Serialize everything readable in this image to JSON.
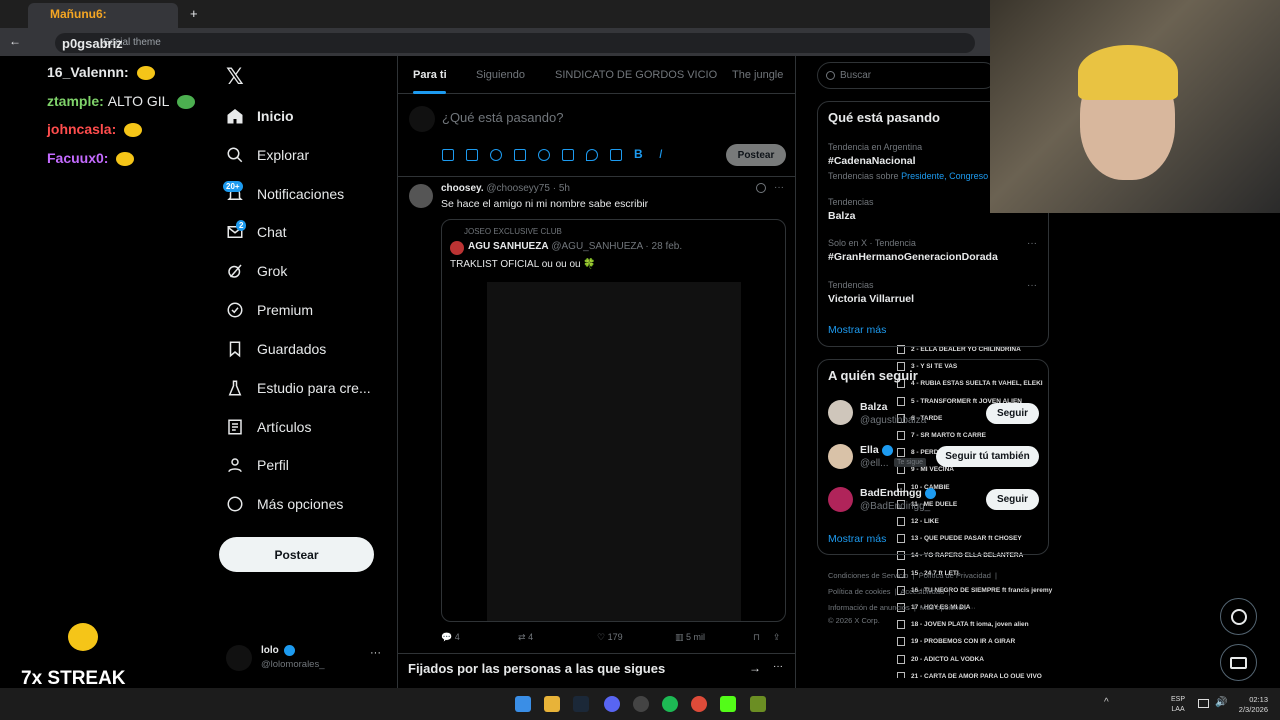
{
  "browser": {
    "tab_title": "Mañunu6:",
    "address_overlay": "p0gsabriz",
    "address_text": "Social theme"
  },
  "chat": [
    {
      "user": "16_Valennn:",
      "msg": "",
      "color": "#e7e9ea"
    },
    {
      "user": "ztample:",
      "msg": "ALTO GIL",
      "color": "#7fd26a"
    },
    {
      "user": "johncasla:",
      "msg": "",
      "color": "#ff4d4d"
    },
    {
      "user": "Facuux0:",
      "msg": "",
      "color": "#c46bff"
    }
  ],
  "streak": "7x STREAK",
  "nav": {
    "home": "Inicio",
    "explore": "Explorar",
    "notifications": "Notificaciones",
    "notif_count": "20+",
    "chat": "Chat",
    "chat_count": "2",
    "grok": "Grok",
    "premium": "Premium",
    "bookmarks": "Guardados",
    "studio": "Estudio para cre...",
    "articles": "Artículos",
    "profile": "Perfil",
    "more": "Más opciones",
    "post": "Postear"
  },
  "account": {
    "name": "lolo",
    "handle": "@lolomorales_"
  },
  "tabs": [
    "Para ti",
    "Siguiendo",
    "SINDICATO DE GORDOS VICIO",
    "The jungle"
  ],
  "composer": {
    "placeholder": "¿Qué está pasando?",
    "post": "Postear"
  },
  "tweet": {
    "name": "choosey.",
    "handle": "@chooseyy75",
    "time": "5h",
    "text": "Se hace el amigo ni mi nombre sabe escribir",
    "quote": {
      "community": "JOSEO EXCLUSIVE CLUB",
      "name": "AGU SANHUEZA",
      "handle": "@AGU_SANHUEZA",
      "date": "28 feb.",
      "text": "TRAKLIST OFICIAL ou ou ou 🍀"
    },
    "tracks": [
      "2 - ELLA DEALER YO CHILINDRINA",
      "3 - Y SI TE VAS",
      "4 - RUBIA ESTAS SUELTA ft VAHEL, ELEKI",
      "5 - TRANSFORMER ft JOVEN ALIEN",
      "6 - TARDE",
      "7 - SR MARTO ft CARRE",
      "8 - PERDON BELEN",
      "9 - MI VECINA",
      "10 - CAMBIE",
      "11 - ME DUELE",
      "12 - LIKE",
      "13 - QUE PUEDE PASAR ft CHOSEY",
      "14 - YO RAPERO ELLA DELANTERA",
      "15 - 24 7 ft LETI",
      "16 - TU NEGRO DE SIEMPRE ft francis jeremy",
      "17 - HOY ES MI DIA",
      "18 - JOVEN PLATA ft ioma, joven alien",
      "19 - PROBEMOS CON IR A GIRAR",
      "20 - ADICTO AL VODKA",
      "21 - CARTA DE AMOR PARA LO QUE VIVO"
    ],
    "stats": {
      "replies": "4",
      "reposts": "4",
      "likes": "179",
      "views": "5 mil"
    }
  },
  "pinned": "Fijados por las personas a las que sigues",
  "search": {
    "placeholder": "Buscar"
  },
  "trends": {
    "title": "Qué está pasando",
    "items": [
      {
        "ctx": "Tendencia en Argentina",
        "name": "#CadenaNacional",
        "sub": "Tendencias sobre",
        "tags": "Presidente, Congreso"
      },
      {
        "ctx": "Tendencias",
        "name": "Balza"
      },
      {
        "ctx": "Solo en X · Tendencia",
        "name": "#GranHermanoGeneracionDorada"
      },
      {
        "ctx": "Tendencias",
        "name": "Victoria Villarruel"
      }
    ],
    "more": "Mostrar más"
  },
  "who": {
    "title": "A quién seguir",
    "items": [
      {
        "name": "Balza",
        "handle": "@agustinbalza",
        "btn": "Seguir"
      },
      {
        "name": "Ella",
        "handle": "@ell...",
        "tag": "Te sigue",
        "btn": "Seguir tú también"
      },
      {
        "name": "BadEndingg",
        "handle": "@BadEndingg_",
        "btn": "Seguir"
      }
    ],
    "more": "Mostrar más"
  },
  "footer": {
    "terms": "Condiciones de Servicio",
    "privacy": "Política de Privacidad",
    "cookies": "Política de cookies",
    "access": "Accesibilidad",
    "ads": "Información de anuncios",
    "more": "Más opciones ···",
    "copy": "© 2026 X Corp."
  },
  "clock": {
    "time": "02:13",
    "date": "2/3/2026",
    "lang": "ESP",
    "layout": "LAA"
  },
  "colors": {
    "accent": "#1d9bf0",
    "bg": "#000000"
  }
}
